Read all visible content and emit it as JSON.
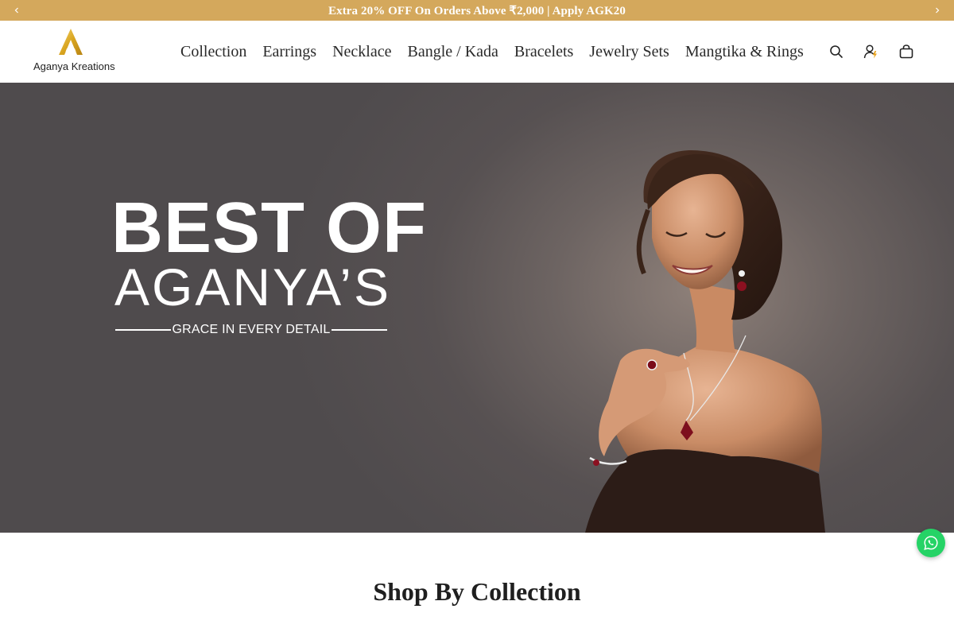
{
  "announcement": {
    "text": "Extra 20% OFF On Orders Above ₹2,000 | Apply AGK20",
    "prev_icon": "chevron-left-icon",
    "next_icon": "chevron-right-icon"
  },
  "brand": {
    "name": "Aganya Kreations",
    "accent_color": "#d4a85c"
  },
  "nav": {
    "items": [
      {
        "label": "Collection"
      },
      {
        "label": "Earrings"
      },
      {
        "label": "Necklace"
      },
      {
        "label": "Bangle / Kada"
      },
      {
        "label": "Bracelets"
      },
      {
        "label": "Jewelry Sets"
      },
      {
        "label": "Mangtika & Rings"
      }
    ]
  },
  "header_icons": [
    "search-icon",
    "account-icon",
    "cart-icon"
  ],
  "hero": {
    "title_line1": "BEST OF",
    "title_line2": "AGANYA’S",
    "tagline": "GRACE IN EVERY DETAIL"
  },
  "whatsapp": {
    "icon": "whatsapp-icon",
    "color": "#25d366"
  },
  "section": {
    "title": "Shop By Collection"
  }
}
